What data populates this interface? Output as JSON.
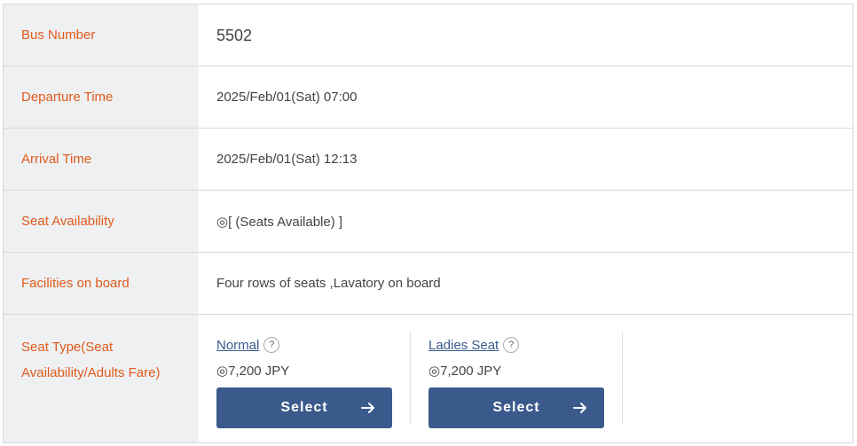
{
  "rows": {
    "bus_number": {
      "label": "Bus Number",
      "value": "5502"
    },
    "departure": {
      "label": "Departure Time",
      "value": "2025/Feb/01(Sat) 07:00"
    },
    "arrival": {
      "label": "Arrival Time",
      "value": "2025/Feb/01(Sat) 12:13"
    },
    "availability": {
      "label": "Seat Availability",
      "value": "◎[ (Seats Available) ]"
    },
    "facilities": {
      "label": "Facilities on board",
      "value": "Four rows of seats  ,Lavatory on board"
    },
    "seat_type": {
      "label_line1": "Seat Type(Seat",
      "label_line2": "Availability/Adults Fare)"
    }
  },
  "seats": [
    {
      "name": "Normal",
      "help": "?",
      "fare": "◎7,200 JPY",
      "button": "Select"
    },
    {
      "name": "Ladies Seat",
      "help": "?",
      "fare": "◎7,200 JPY",
      "button": "Select"
    }
  ],
  "icons": {
    "help": "question-circle-icon",
    "arrow": "arrow-right-icon"
  },
  "colors": {
    "label_text": "#e05a1a",
    "label_bg": "#eff0f2",
    "button_bg": "#3a5a8c",
    "link": "#3a5a8c"
  }
}
